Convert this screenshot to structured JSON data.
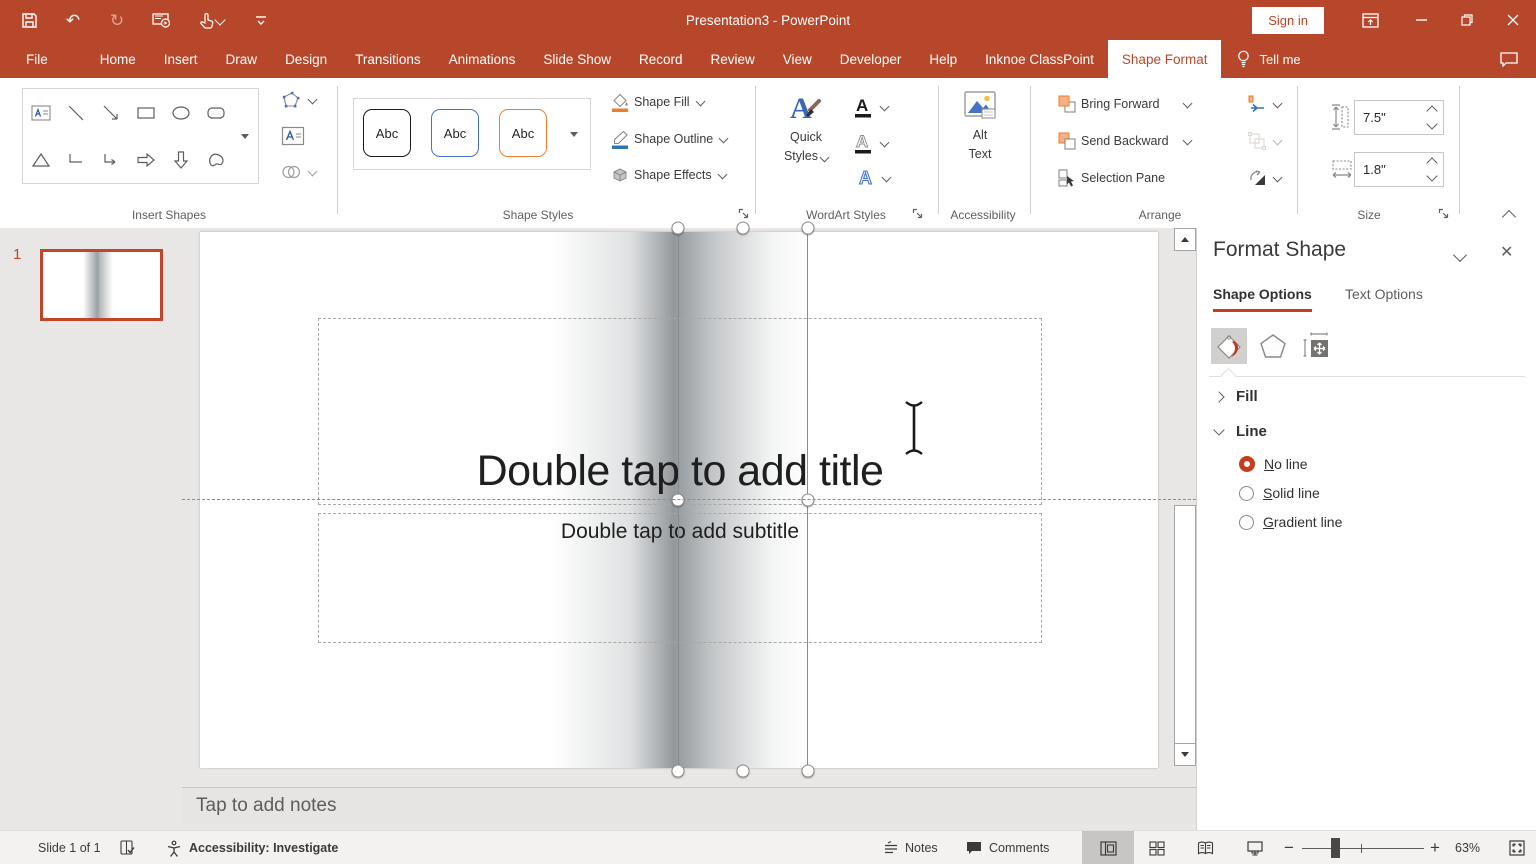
{
  "app": {
    "title": "Presentation3  -  PowerPoint",
    "sign_in": "Sign in",
    "tell_me": "Tell me"
  },
  "tabs": [
    {
      "label": "File"
    },
    {
      "label": "Home"
    },
    {
      "label": "Insert"
    },
    {
      "label": "Draw"
    },
    {
      "label": "Design"
    },
    {
      "label": "Transitions"
    },
    {
      "label": "Animations"
    },
    {
      "label": "Slide Show"
    },
    {
      "label": "Record"
    },
    {
      "label": "Review"
    },
    {
      "label": "View"
    },
    {
      "label": "Developer"
    },
    {
      "label": "Help"
    },
    {
      "label": "Inknoe ClassPoint"
    },
    {
      "label": "Shape Format",
      "active": true
    }
  ],
  "ribbon": {
    "insert_shapes": {
      "label": "Insert Shapes"
    },
    "shape_styles": {
      "label": "Shape Styles",
      "preview": "Abc",
      "fill": "Shape Fill",
      "outline": "Shape Outline",
      "effects": "Shape Effects"
    },
    "wordart": {
      "label": "WordArt Styles",
      "quick": "Quick",
      "styles": "Styles"
    },
    "accessibility": {
      "label": "Accessibility",
      "alt": "Alt",
      "text": "Text"
    },
    "arrange": {
      "label": "Arrange",
      "bring_forward": "Bring Forward",
      "send_backward": "Send Backward",
      "selection_pane": "Selection Pane"
    },
    "size": {
      "label": "Size",
      "height": "7.5\"",
      "width": "1.8\""
    }
  },
  "slides_panel": {
    "slide_number": "1"
  },
  "slide": {
    "title_placeholder": "Double tap to add title",
    "subtitle_placeholder": "Double tap to add subtitle"
  },
  "notes": {
    "placeholder": "Tap to add notes"
  },
  "format_shape": {
    "title": "Format Shape",
    "tab_shape_options": "Shape Options",
    "tab_text_options": "Text Options",
    "fill_section": "Fill",
    "line_section": "Line",
    "options": [
      {
        "key": "N",
        "rest": "o line",
        "selected": true
      },
      {
        "key": "S",
        "rest": "olid line",
        "selected": false
      },
      {
        "key": "G",
        "rest": "radient line",
        "selected": false
      }
    ]
  },
  "status": {
    "slide_indicator": "Slide 1 of 1",
    "accessibility_status": "Accessibility: Investigate",
    "notes_label": "Notes",
    "comments_label": "Comments",
    "zoom_level": "63%"
  },
  "colors": {
    "brand": "#B7472A",
    "accent": "#C43E1C",
    "style_black": "#1a1a1a",
    "style_blue": "#4472C4",
    "style_orange": "#ED7D31"
  }
}
